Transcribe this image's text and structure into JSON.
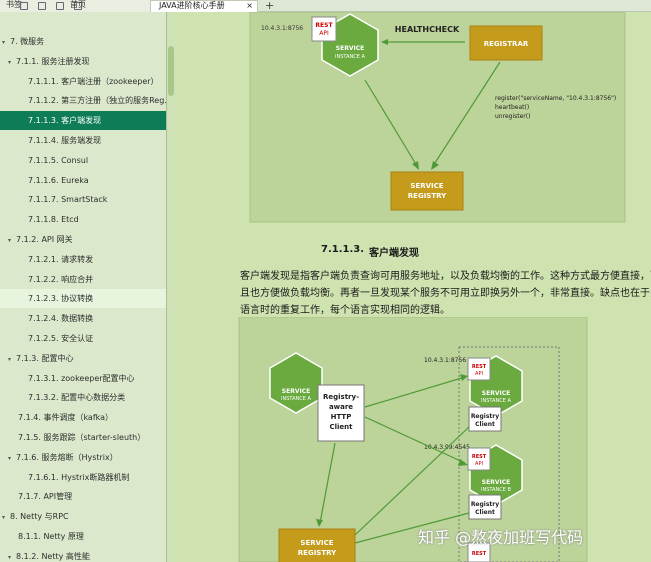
{
  "tabs": {
    "left_label": "书签",
    "home_label": "首页",
    "doc_title": "JAVA进阶核心手册",
    "close_glyph": "×",
    "add_glyph": "+"
  },
  "toc": [
    {
      "label": "7.  微服务",
      "indent": 2,
      "arrow": true
    },
    {
      "label": "7.1.1. 服务注册发现",
      "indent": 8,
      "arrow": true
    },
    {
      "label": "7.1.1.1. 客户端注册（zookeeper）",
      "indent": 28
    },
    {
      "label": "7.1.1.2. 第三方注册（独立的服务Reg...",
      "indent": 28
    },
    {
      "label": "7.1.1.3. 客户端发现",
      "indent": 28,
      "active": true
    },
    {
      "label": "7.1.1.4. 服务端发现",
      "indent": 28
    },
    {
      "label": "7.1.1.5. Consul",
      "indent": 28
    },
    {
      "label": "7.1.1.6. Eureka",
      "indent": 28
    },
    {
      "label": "7.1.1.7. SmartStack",
      "indent": 28
    },
    {
      "label": "7.1.1.8. Etcd",
      "indent": 28
    },
    {
      "label": "7.1.2. API 网关",
      "indent": 8,
      "arrow": true
    },
    {
      "label": "7.1.2.1. 请求转发",
      "indent": 28
    },
    {
      "label": "7.1.2.2. 响应合并",
      "indent": 28
    },
    {
      "label": "7.1.2.3. 协议转换",
      "indent": 28,
      "hover": true
    },
    {
      "label": "7.1.2.4. 数据转换",
      "indent": 28
    },
    {
      "label": "7.1.2.5. 安全认证",
      "indent": 28
    },
    {
      "label": "7.1.3. 配置中心",
      "indent": 8,
      "arrow": true
    },
    {
      "label": "7.1.3.1. zookeeper配置中心",
      "indent": 28
    },
    {
      "label": "7.1.3.2. 配置中心数据分类",
      "indent": 28
    },
    {
      "label": "7.1.4. 事件调度（kafka）",
      "indent": 18
    },
    {
      "label": "7.1.5. 服务跟踪（starter-sleuth）",
      "indent": 18
    },
    {
      "label": "7.1.6. 服务熔断（Hystrix）",
      "indent": 8,
      "arrow": true
    },
    {
      "label": "7.1.6.1. Hystrix断路器机制",
      "indent": 28
    },
    {
      "label": "7.1.7. API管理",
      "indent": 18
    },
    {
      "label": "8. Netty 与RPC",
      "indent": 2,
      "arrow": true
    },
    {
      "label": "8.1.1. Netty 原理",
      "indent": 18
    },
    {
      "label": "8.1.2. Netty 高性能",
      "indent": 8,
      "arrow": true
    }
  ],
  "fig1": {
    "ip": "10.4.3.1:8756",
    "rest": [
      "REST",
      "API"
    ],
    "service_a": [
      "SERVICE",
      "INSTANCE A"
    ],
    "healthcheck": "HEALTHCHECK",
    "registrar": "REGISTRAR",
    "register_lines": [
      "register(\"serviceName, \"10.4.3.1:8756\")",
      "heartbeat()",
      "unregister()"
    ],
    "registry": [
      "SERVICE",
      "REGISTRY"
    ]
  },
  "section": {
    "number": "7.1.1.3.",
    "title": "客户端发现",
    "para_lines": [
      "客户端发现是指客户端负责查询可用服务地址，以及负载均衡的工作。这种方式最方便直接，而",
      "且也方便做负载均衡。再者一旦发现某个服务不可用立即换另外一个，非常直接。缺点也在于多",
      "语言时的重复工作，每个语言实现相同的逻辑。"
    ]
  },
  "fig2": {
    "service_a": [
      "SERVICE",
      "INSTANCE A"
    ],
    "http_client": [
      "Registry-",
      "aware",
      "HTTP",
      "Client"
    ],
    "ip1": "10.4.3.1:8756",
    "ip2": "10.4.3.99:4545",
    "rest": [
      "REST",
      "API"
    ],
    "registry_client": [
      "Registry",
      "Client"
    ],
    "service_b": [
      "SERVICE",
      "INSTANCE B"
    ],
    "registry": [
      "SERVICE",
      "REGISTRY"
    ]
  },
  "watermark": "知乎 @熬夜加班写代码",
  "colors": {
    "accent": "#0e7d57",
    "hex_green": "#6aaa3f",
    "registry_gold": "#c49b1b",
    "figure_bg": "#bcd39a",
    "page_bg": "#cfe3b0"
  }
}
